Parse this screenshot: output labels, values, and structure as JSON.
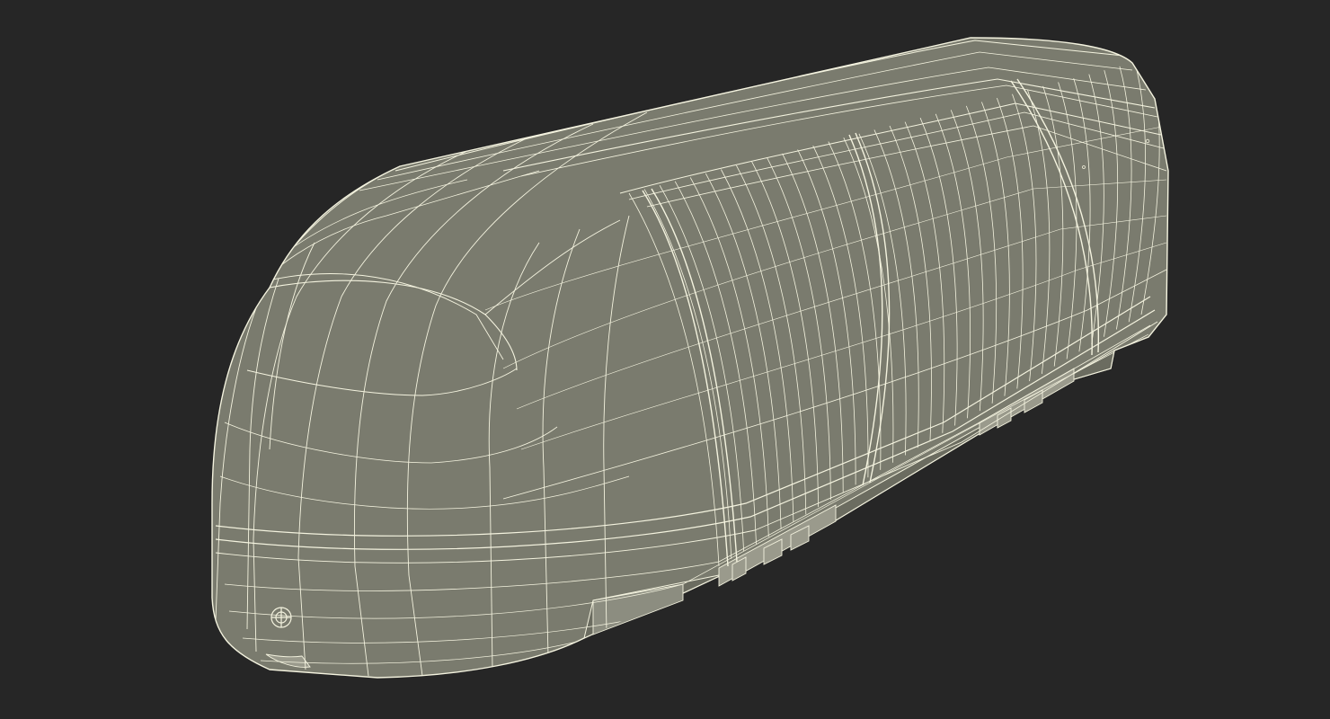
{
  "scene": {
    "subject": "train-car-wireframe",
    "colors": {
      "background": "#262626",
      "body_fill": "#7a7b6e",
      "body_fill_dark": "#6b6c60",
      "wire": "#f4f3df",
      "skirt": "#9a9a8c",
      "shadow_panel": "#5e5f55"
    }
  }
}
